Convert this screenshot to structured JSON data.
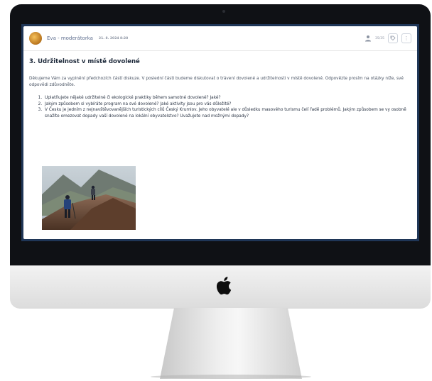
{
  "post": {
    "author": "Eva - moderátorka",
    "date": "21. 8. 2024 8:28",
    "participants": "35/35",
    "title": "3. Udržitelnost v místě dovolené",
    "intro": "Děkujeme Vám za vyplnění předchozích částí diskuze. V poslední části budeme diskutovat o trávení dovolené a udržitelnosti v místě dovolené. Odpovězte prosím na otázky níže, své odpovědi zdůvodněte.",
    "questions": [
      "Uplatňujete nějaké udržitelné či ekologické praktiky během samotné dovolené? Jaké?",
      "Jakým způsobem si vybíráte program na své dovolené? Jaké aktivity jsou pro vás důležité?",
      "V Česku je jedním z nejnavštěvovanějších turistických cílů Český Krumlov. Jeho obyvatelé ale v důsledku masového turismu čelí řadě problémů. Jakým způsobem se vy osobně snažíte omezovat dopady vaší dovolené na lokální obyvatelstvo? Uvažujete nad možnými dopady?"
    ],
    "icons": {
      "avatar": "avatar-icon",
      "participants": "user-icon",
      "tag": "tag-icon",
      "more": "more-icon"
    }
  },
  "device": {
    "logo": "",
    "colors": {
      "bezel": "#0f1115",
      "screen_border": "#1f3657",
      "chin": "#e8e8e8",
      "link": "#5b6b8c"
    }
  }
}
